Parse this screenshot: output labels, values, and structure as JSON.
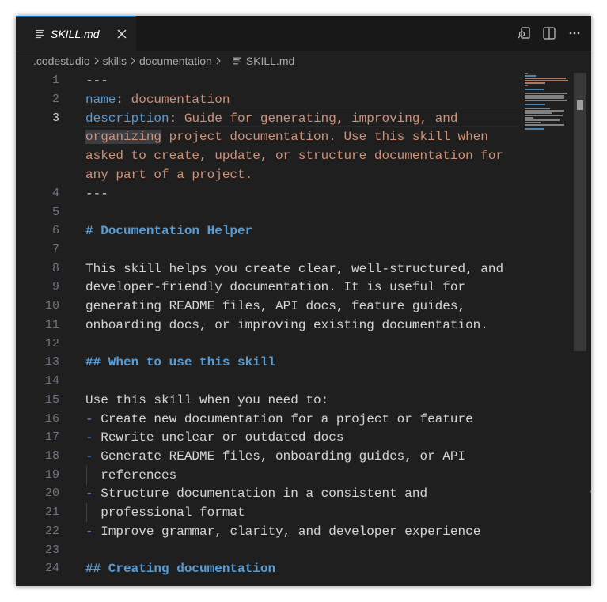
{
  "tab": {
    "label": "SKILL.md",
    "file_icon": "markdown-file-icon",
    "close_icon": "close-icon"
  },
  "actions": {
    "preview_icon": "open-preview-to-side-icon",
    "split_icon": "split-editor-icon",
    "more_icon": "more-actions-icon"
  },
  "breadcrumbs": {
    "items": [
      ".codestudio",
      "skills",
      "documentation",
      "SKILL.md"
    ],
    "separator_icon": "chevron-right-icon"
  },
  "editor": {
    "language": "markdown",
    "active_line": 3,
    "line_numbers": [
      "1",
      "2",
      "3",
      "",
      "",
      "",
      "4",
      "5",
      "6",
      "7",
      "8",
      "9",
      "10",
      "11",
      "12",
      "13",
      "14",
      "15",
      "16",
      "17",
      "18",
      "19",
      "20",
      "21",
      "22",
      "23",
      "24"
    ],
    "lines": {
      "l1": "---",
      "l2_key": "name",
      "l2_colon": ":",
      "l2_val": " documentation",
      "l3_key": "description",
      "l3_colon": ":",
      "l3_val": " Guide for generating, improving, and",
      "l3b_sel": "organizing",
      "l3b_rest": " project documentation. Use this skill when",
      "l3c": "asked to create, update, or structure documentation for",
      "l3d": "any part of a project.",
      "l4": "---",
      "l6": "# Documentation Helper",
      "l8": "This skill helps you create clear, well-structured, and",
      "l9": "developer-friendly documentation. It is useful for",
      "l10": "generating README files, API docs, feature guides,",
      "l11": "onboarding docs, or improving existing documentation.",
      "l13": "## When to use this skill",
      "l15": "Use this skill when you need to:",
      "l16_marker": "-",
      "l16": " Create new documentation for a project or feature",
      "l17_marker": "-",
      "l17": " Rewrite unclear or outdated docs",
      "l18_marker": "-",
      "l18": " Generate README files, onboarding guides, or API",
      "l19": "  references",
      "l20_marker": "-",
      "l20": " Structure documentation in a consistent and",
      "l21": "  professional format",
      "l22_marker": "-",
      "l22": " Improve grammar, clarity, and developer experience",
      "l24": "## Creating documentation"
    }
  },
  "colors": {
    "editor_bg": "#1f1f1f",
    "tabbar_bg": "#181818",
    "accent": "#0078d4",
    "keyword": "#569cd6",
    "string": "#ce9178",
    "text": "#d4d4d4",
    "line_number": "#6e7681"
  }
}
